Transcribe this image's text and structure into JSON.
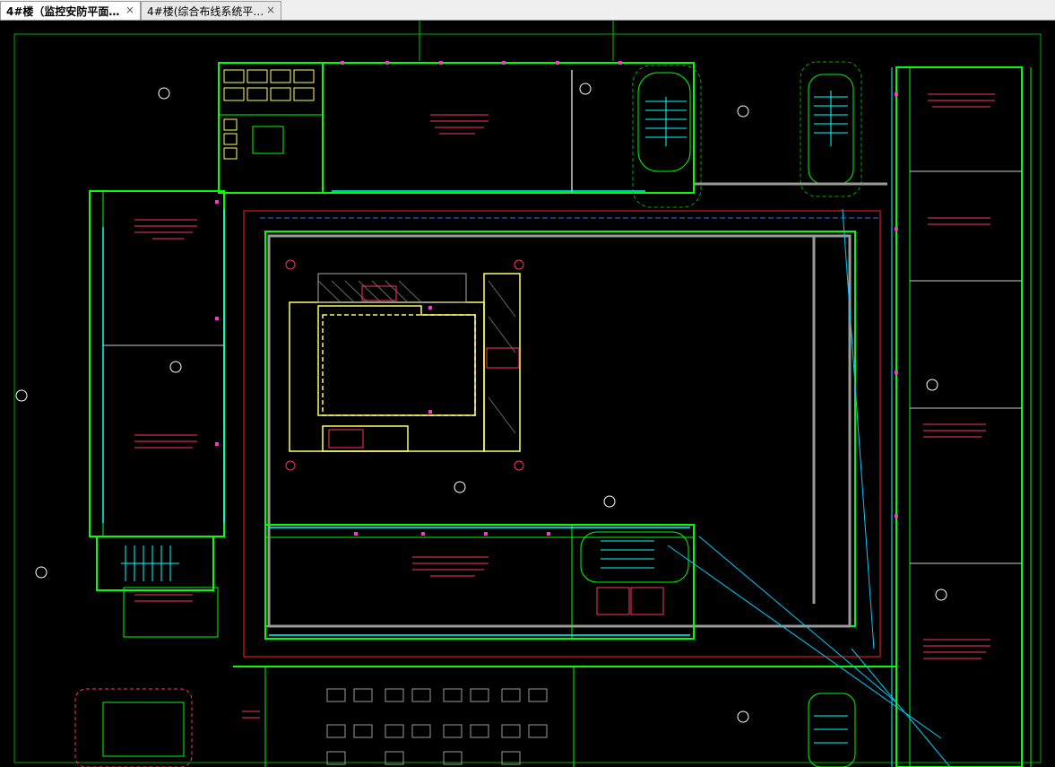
{
  "tabs": [
    {
      "label": "4#楼（监控安防平面…",
      "close": "×",
      "active": true
    },
    {
      "label": "4#楼(综合布线系统平…",
      "close": "×",
      "active": false
    }
  ],
  "colors": {
    "background": "#000000",
    "wall": "#00ff00",
    "cable": "#00ffff",
    "annotation": "#ff3366",
    "core": "#ffff66",
    "grid": "#808080",
    "hatch": "#9a9a9a"
  },
  "icons": {
    "tab_close": "close-icon",
    "camera": "camera-icon"
  }
}
